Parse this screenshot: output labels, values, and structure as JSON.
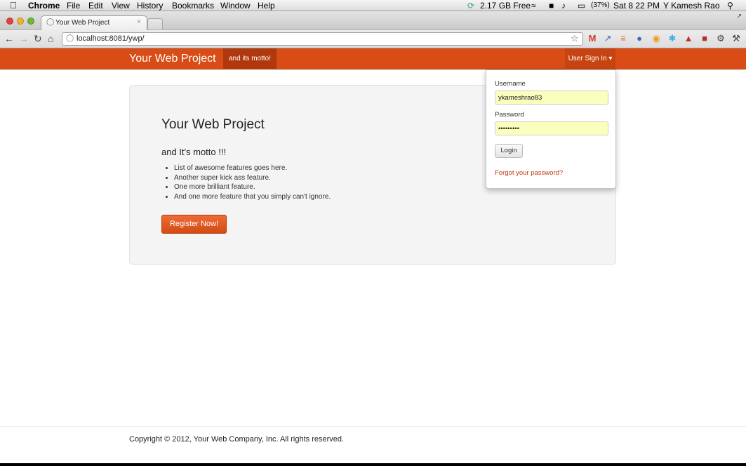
{
  "menubar": {
    "app": "Chrome",
    "items": [
      "File",
      "Edit",
      "View",
      "History",
      "Bookmarks",
      "Window",
      "Help"
    ],
    "disk_free": "2.17 GB Free",
    "battery": "(37%)",
    "clock": "Sat 8 22 PM",
    "user": "Y Kamesh Rao"
  },
  "browser": {
    "tab_title": "Your Web Project",
    "url": "localhost:8081/ywp/"
  },
  "site": {
    "brand": "Your Web Project",
    "motto_nav": "and its motto!",
    "signin_label": "User Sign In ▾",
    "hero": {
      "title": "Your Web Project",
      "subtitle": "and It's motto !!!",
      "features": [
        "List of awesome features goes here.",
        "Another super kick ass feature.",
        "One more brilliant feature.",
        "And one more feature that you simply can't ignore."
      ],
      "register_label": "Register Now!"
    },
    "login": {
      "username_label": "Username",
      "username_value": "ykameshrao83",
      "password_label": "Password",
      "password_value": "•••••••••",
      "login_label": "Login",
      "forgot_label": "Forgot your password?"
    },
    "footer": "Copyright © 2012, Your Web Company, Inc. All rights reserved."
  },
  "colors": {
    "brand": "#d94c15",
    "brand_dark": "#b0380c",
    "autofill": "#faffbd"
  }
}
